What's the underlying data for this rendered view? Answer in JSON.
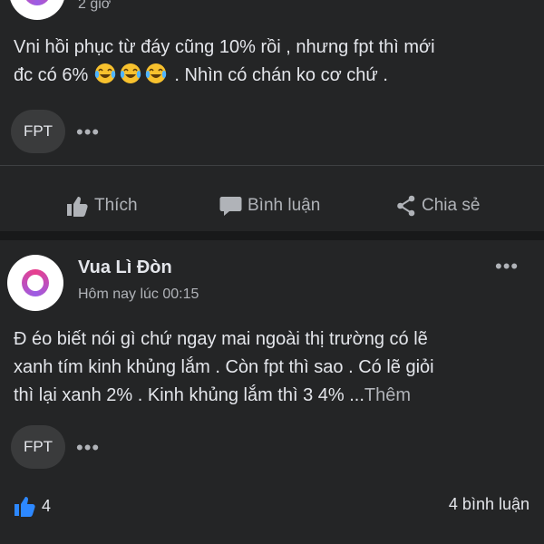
{
  "post1": {
    "timestamp": "2 giờ",
    "text_line1": "Vni hồi phục từ đáy cũng 10% rồi , nhưng fpt thì mới",
    "text_line2_prefix": "đc có 6%",
    "text_line2_suffix": ". Nhìn có chán ko cơ chứ .",
    "emoji_names": [
      "joy-emoji",
      "joy-emoji",
      "joy-emoji"
    ],
    "tag": "FPT",
    "more": "•••"
  },
  "actions": {
    "like": "Thích",
    "comment": "Bình luận",
    "share": "Chia sẻ"
  },
  "post2": {
    "author": "Vua Lì Đòn",
    "timestamp": "Hôm nay lúc 00:15",
    "text_line1": "Đ éo biết nói gì chứ ngay mai ngoài thị trường có lẽ",
    "text_line2": "xanh tím kinh khủng lắm . Còn fpt thì sao . Có lẽ giỏi",
    "text_line3": "thì lại xanh 2% . Kinh khủng lắm thì 3 4% ...",
    "see_more": "Thêm",
    "tag": "FPT",
    "more": "•••",
    "options": "•••",
    "like_count": "4",
    "comment_count": "4 bình luận"
  },
  "colors": {
    "background": "#242526",
    "text": "#e4e6eb",
    "muted": "#b0b3b8",
    "like_blue": "#2d88ff"
  }
}
